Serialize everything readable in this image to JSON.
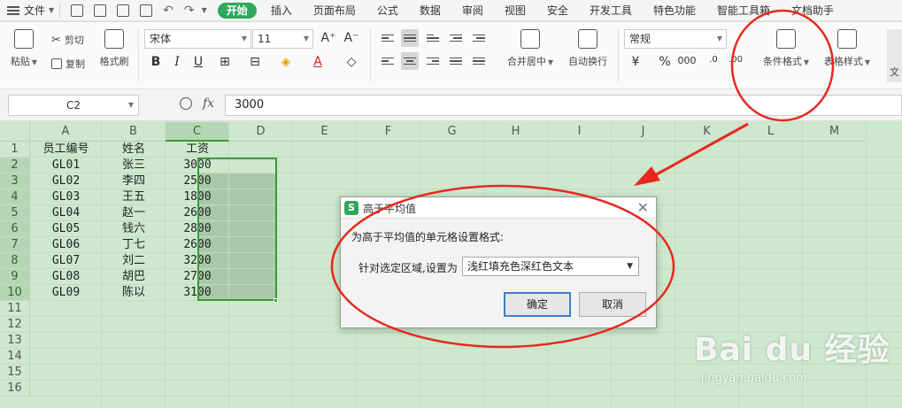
{
  "menubar": {
    "file_label": "文件",
    "tabs": [
      "开始",
      "插入",
      "页面布局",
      "公式",
      "数据",
      "审阅",
      "视图",
      "安全",
      "开发工具",
      "特色功能",
      "智能工具箱",
      "文档助手"
    ],
    "active_tab": "开始"
  },
  "ribbon": {
    "paste": "粘贴",
    "cut": "剪切",
    "copy": "复制",
    "format_painter": "格式刷",
    "font_name": "宋体",
    "font_size": "11",
    "merge_center": "合并居中",
    "wrap_text": "自动换行",
    "number_format": "常规",
    "conditional_format": "条件格式",
    "table_style": "表格样式",
    "text_tools": "文"
  },
  "formula_bar": {
    "name_box": "C2",
    "fx": "fx",
    "value": "3000"
  },
  "sheet": {
    "columns": [
      "A",
      "B",
      "C",
      "D",
      "E",
      "F",
      "G",
      "H",
      "I",
      "J",
      "K",
      "L",
      "M"
    ],
    "row_numbers": [
      "1",
      "2",
      "3",
      "4",
      "5",
      "6",
      "7",
      "8",
      "9",
      "10",
      "11",
      "12",
      "13",
      "14",
      "15",
      "16"
    ],
    "headers": [
      "员工编号",
      "姓名",
      "工资"
    ],
    "rows": [
      [
        "GL01",
        "张三",
        "3000"
      ],
      [
        "GL02",
        "李四",
        "2500"
      ],
      [
        "GL03",
        "王五",
        "1800"
      ],
      [
        "GL04",
        "赵一",
        "2600"
      ],
      [
        "GL05",
        "钱六",
        "2800"
      ],
      [
        "GL06",
        "丁七",
        "2600"
      ],
      [
        "GL07",
        "刘二",
        "3200"
      ],
      [
        "GL08",
        "胡巴",
        "2700"
      ],
      [
        "GL09",
        "陈以",
        "3100"
      ]
    ],
    "selected_column": "C"
  },
  "dialog": {
    "logo": "S",
    "title": "高于平均值",
    "prompt": "为高于平均值的单元格设置格式:",
    "range_label": "针对选定区域,设置为",
    "format_value": "浅红填充色深红色文本",
    "ok": "确定",
    "cancel": "取消"
  },
  "watermark": {
    "brand": "Bai du 经验",
    "url": "jingyan.baidu.com"
  },
  "colors": {
    "accent_green": "#2fa85a",
    "sheet_bg": "#cde8cd",
    "annotation_red": "#e8281e"
  }
}
